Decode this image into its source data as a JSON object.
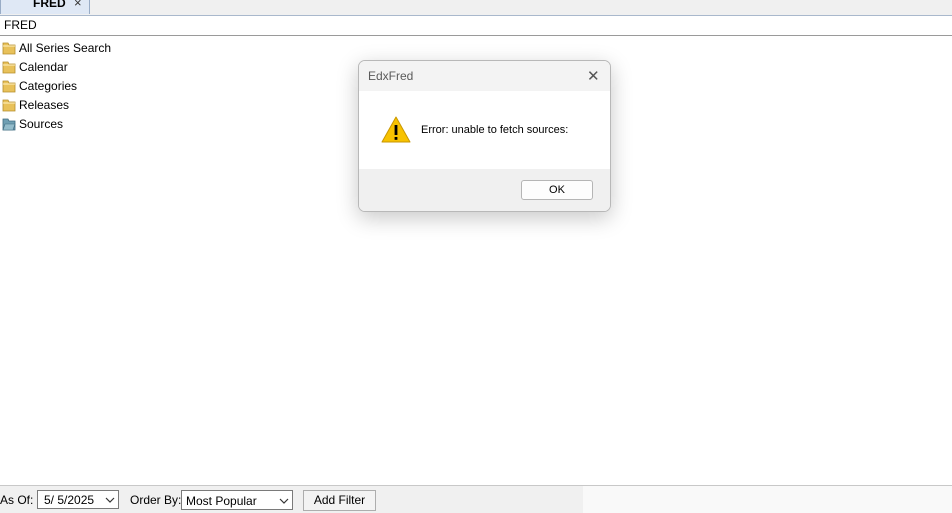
{
  "tab": {
    "label": "FRED",
    "close_glyph": "×"
  },
  "header": {
    "title": "FRED"
  },
  "tree": {
    "items": [
      {
        "label": "All Series Search",
        "icon": "folder-icon"
      },
      {
        "label": "Calendar",
        "icon": "folder-icon"
      },
      {
        "label": "Categories",
        "icon": "folder-icon"
      },
      {
        "label": "Releases",
        "icon": "folder-icon"
      },
      {
        "label": "Sources",
        "icon": "folder-open-icon"
      }
    ]
  },
  "dialog": {
    "title": "EdxFred",
    "close_glyph": "✕",
    "message": "Error: unable to fetch sources:",
    "ok_label": "OK",
    "icon": "warning-icon"
  },
  "bottom": {
    "as_of_label": "As Of:",
    "date_value": "5/  5/2025",
    "order_by_label": "Order By:",
    "order_by_value": "Most Popular",
    "add_filter_label": "Add Filter"
  },
  "colors": {
    "warning": "#f7c200",
    "folder": "#e8c15a",
    "folder_open": "#6f9fb3"
  }
}
